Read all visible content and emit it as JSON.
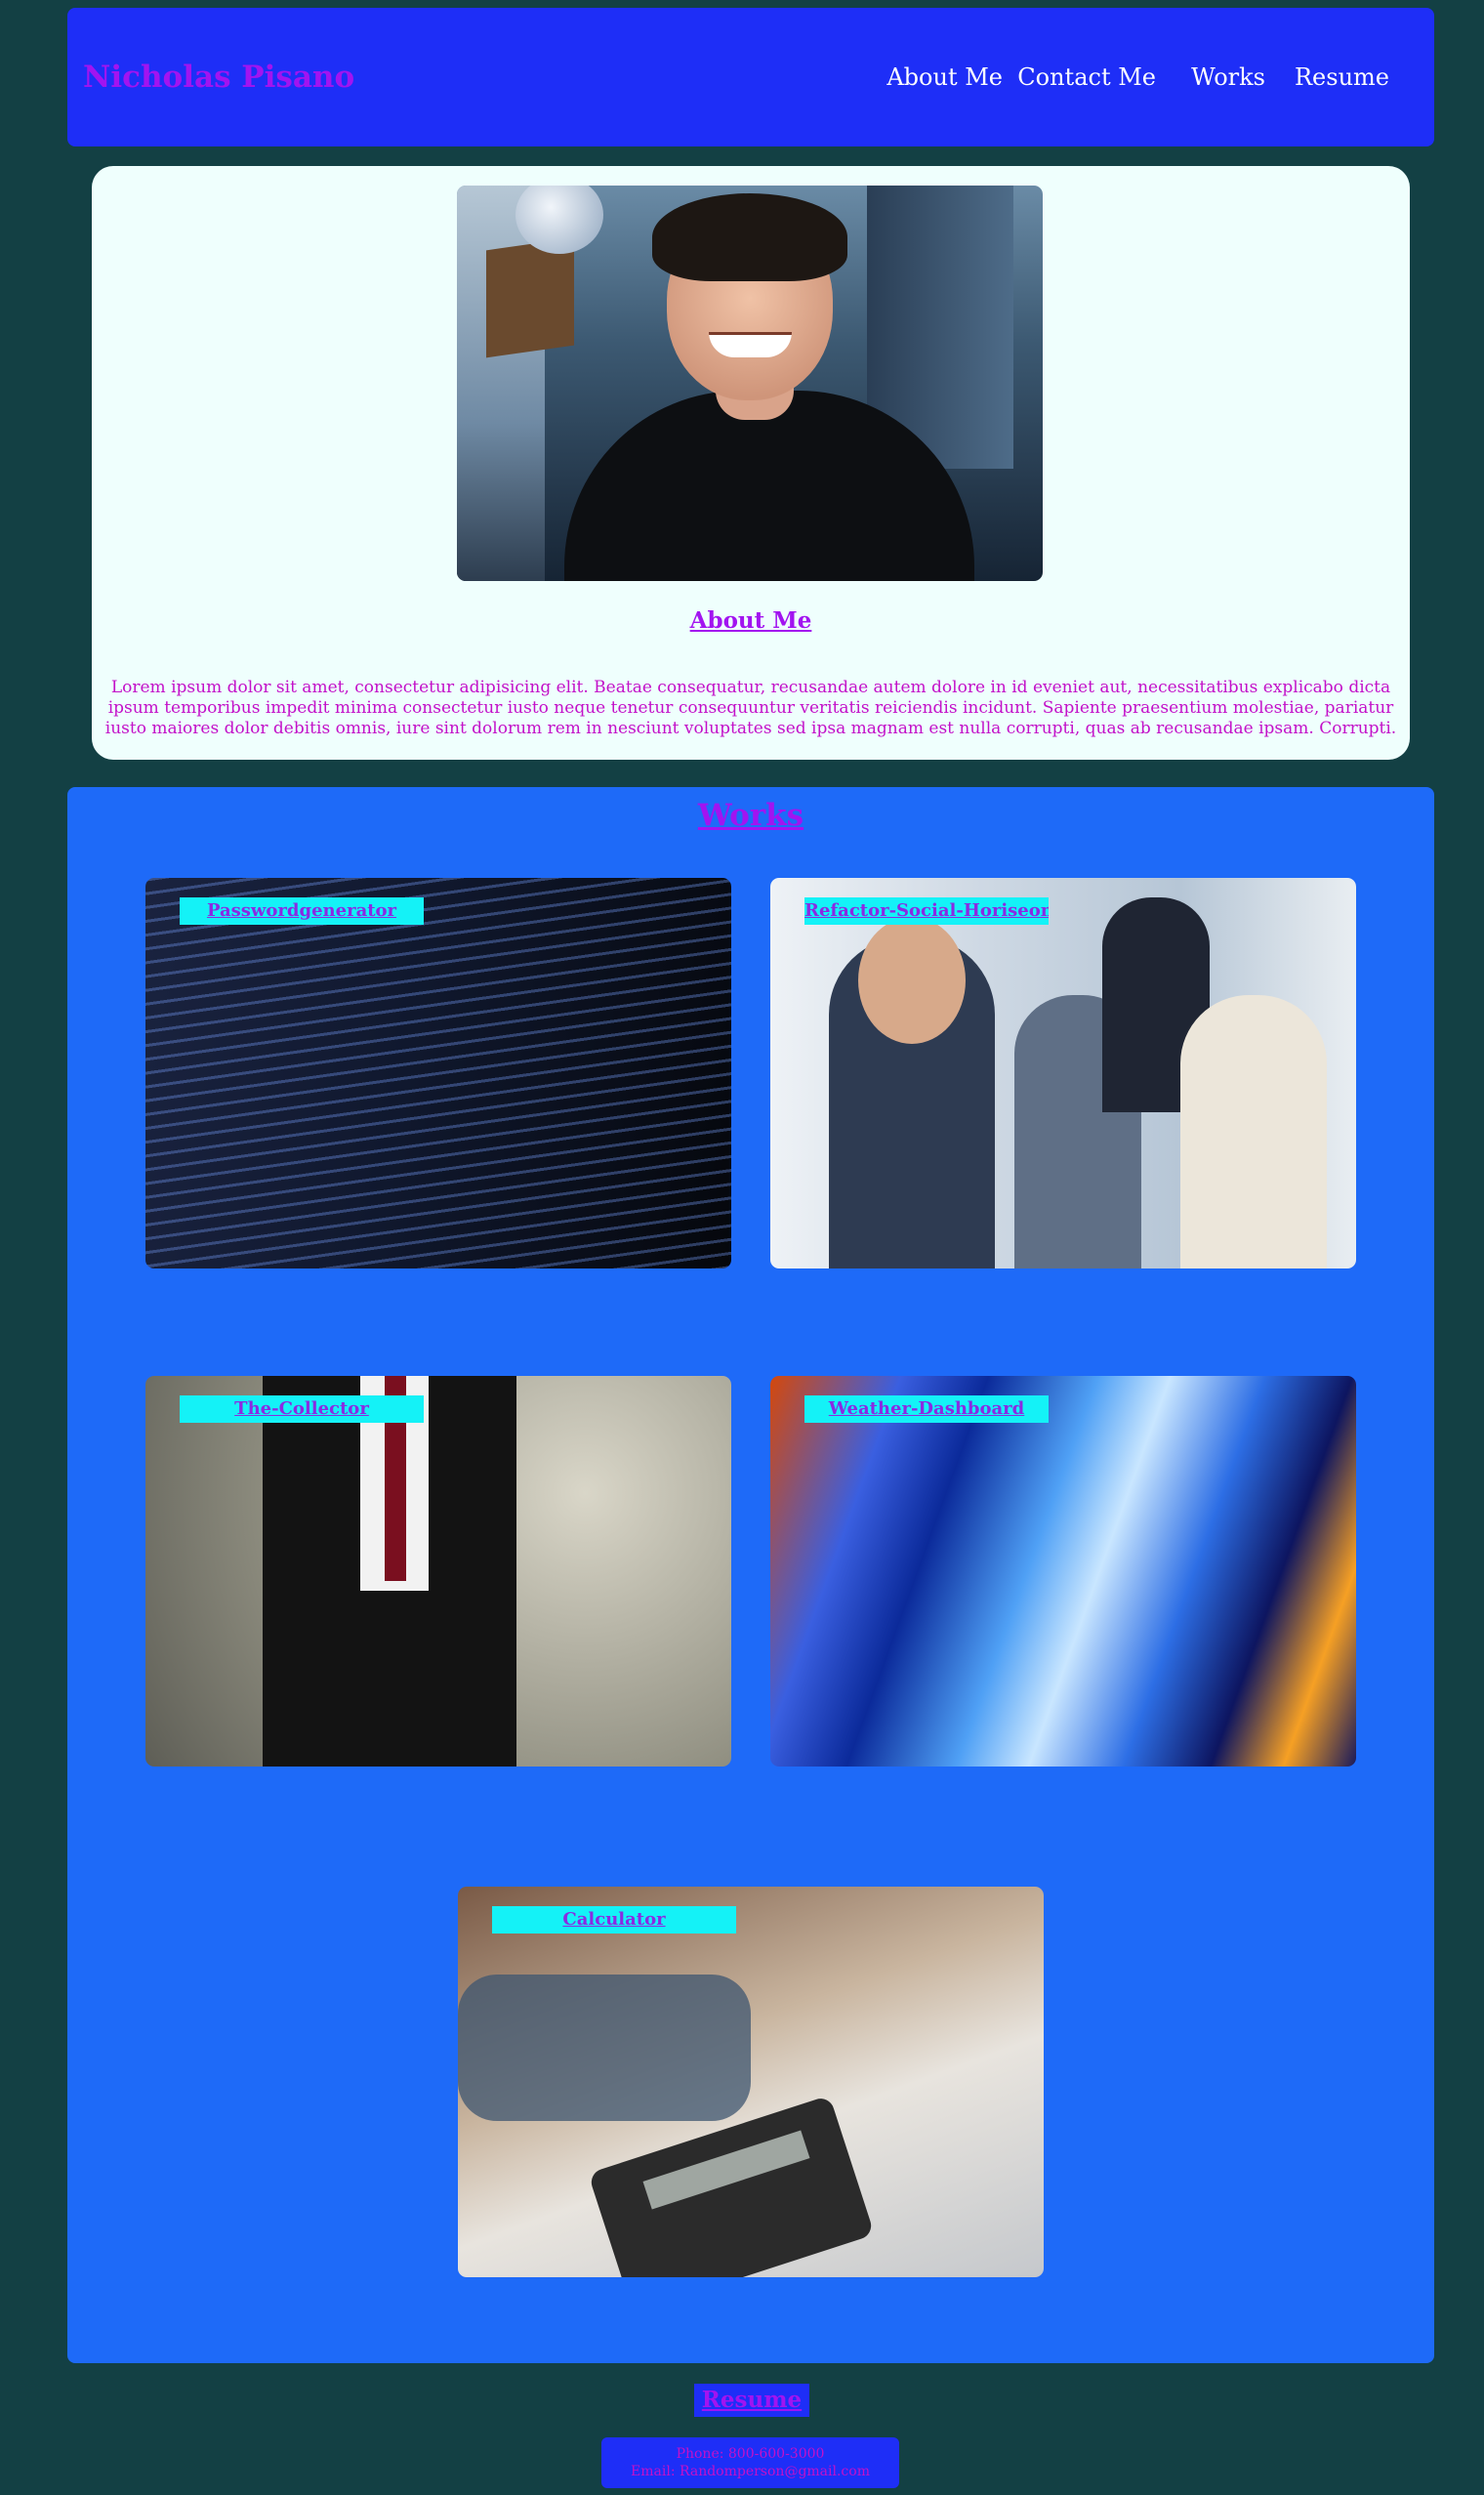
{
  "header": {
    "title": "Nicholas Pisano",
    "nav": [
      "About Me",
      "Contact Me",
      "Works",
      "Resume"
    ]
  },
  "about": {
    "heading": "About Me",
    "text": "Lorem ipsum dolor sit amet, consectetur adipisicing elit. Beatae consequatur, recusandae autem dolore in id eveniet aut, necessitatibus explicabo dicta ipsum temporibus impedit minima consectetur iusto neque tenetur consequuntur veritatis reiciendis incidunt. Sapiente praesentium molestiae, pariatur iusto maiores dolor debitis omnis, iure sint dolorum rem in nesciunt voluptates sed ipsa magnam est nulla corrupti, quas ab recusandae ipsam. Corrupti."
  },
  "works": {
    "heading": "Works",
    "items": [
      {
        "label": "Passwordgenerator"
      },
      {
        "label": "Refactor-Social-Horiseon"
      },
      {
        "label": "The-Collector"
      },
      {
        "label": "Weather-Dashboard"
      },
      {
        "label": "Calculator"
      }
    ]
  },
  "footer": {
    "resume": "Resume",
    "phone": "Phone: 800-600-3000",
    "email": "Email: Randomperson@gmail.com"
  },
  "colors": {
    "header_bg": "#1e2ef7",
    "works_bg": "#1e6af8",
    "page_bg": "#134044",
    "accent_purple": "#a214f0",
    "label_bg": "#14f2f7"
  }
}
